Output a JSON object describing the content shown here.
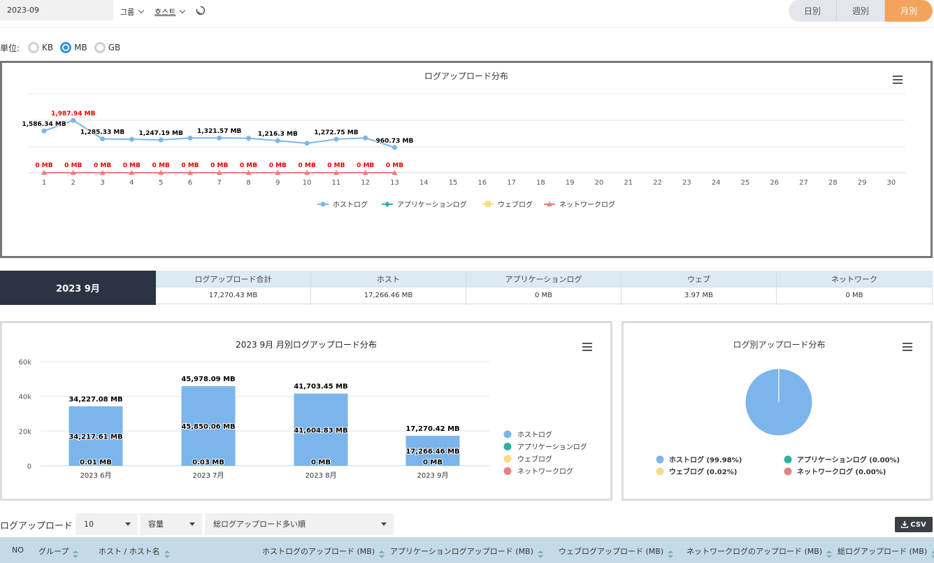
{
  "topbar": {
    "date": "2023-09",
    "group_label": "그룹",
    "host_label": "호스트",
    "period_buttons": [
      "日別",
      "週別",
      "月別"
    ],
    "active_period": "月別"
  },
  "units": {
    "label": "単位:",
    "options": [
      "KB",
      "MB",
      "GB"
    ],
    "selected": "MB"
  },
  "line_chart": {
    "title": "ログアップロード分布"
  },
  "summary": {
    "period": "2023 9月",
    "headers": [
      "ログアップロード合計",
      "ホスト",
      "アプリケーションログ",
      "ウェブ",
      "ネットワーク"
    ],
    "values": [
      "17,270.43 MB",
      "17,266.46 MB",
      "0 MB",
      "3.97 MB",
      "0 MB"
    ]
  },
  "bar_chart": {
    "title": "2023 9月 月別ログアップロード分布"
  },
  "pie_chart": {
    "title": "ログ別アップロード分布",
    "legend": [
      "ホストログ (99.98%)",
      "アプリケーションログ (0.00%)",
      "ウェブログ (0.02%)",
      "ネットワークログ (0.00%)"
    ]
  },
  "table_controls": {
    "title": "ログアップロード",
    "page_size": "10",
    "metric": "容量",
    "sort": "総ログアップロード多い順",
    "csv_label": "CSV"
  },
  "table_headers": [
    "NO",
    "グループ",
    "ホスト / ホスト名",
    "ホストログのアップロード (MB)",
    "アプリケーションログアップロード (MB)",
    "ウェブログアップロード (MB)",
    "ネットワークログのアップロード (MB)",
    "総ログアップロード (MB)"
  ],
  "colors": {
    "host": "#7cb5ec",
    "app": "#2bb3a0",
    "web": "#f7d98a",
    "network": "#e77f7f",
    "accent": "#f3a45c"
  },
  "chart_data": [
    {
      "type": "line",
      "title": "ログアップロード分布",
      "x": [
        1,
        2,
        3,
        4,
        5,
        6,
        7,
        8,
        9,
        10,
        11,
        12,
        13,
        14,
        15,
        16,
        17,
        18,
        19,
        20,
        21,
        22,
        23,
        24,
        25,
        26,
        27,
        28,
        29,
        30
      ],
      "series": [
        {
          "name": "ホストログ",
          "values": [
            1586.34,
            1987.94,
            1285.33,
            1270,
            1247.19,
            1318,
            1321.57,
            1310,
            1216.3,
            1120,
            1272.75,
            1320,
            960.73
          ]
        },
        {
          "name": "アプリケーションログ",
          "values": [
            0,
            0,
            0,
            0,
            0,
            0,
            0,
            0,
            0,
            0,
            0,
            0,
            0
          ]
        },
        {
          "name": "ウェブログ",
          "values": [
            0,
            0,
            0,
            0,
            0,
            0,
            0,
            0,
            0,
            0,
            0,
            0,
            0
          ]
        },
        {
          "name": "ネットワークログ",
          "values": [
            0,
            0,
            0,
            0,
            0,
            0,
            0,
            0,
            0,
            0,
            0,
            0,
            0
          ]
        }
      ],
      "labels": {
        "host": [
          {
            "day": 1,
            "text": "1,586.34 MB"
          },
          {
            "day": 2,
            "text": "1,987.94 MB"
          },
          {
            "day": 3,
            "text": "1,285.33 MB"
          },
          {
            "day": 5,
            "text": "1,247.19 MB"
          },
          {
            "day": 7,
            "text": "1,321.57 MB"
          },
          {
            "day": 9,
            "text": "1,216.3 MB"
          },
          {
            "day": 11,
            "text": "1,272.75 MB"
          },
          {
            "day": 13,
            "text": "960.73 MB"
          }
        ],
        "zero_label": "0 MB"
      },
      "ylim": [
        0,
        3000
      ],
      "legend": "bottom"
    },
    {
      "type": "bar",
      "title": "2023 9月 月別ログアップロード分布",
      "categories": [
        "2023 6月",
        "2023 7月",
        "2023 8月",
        "2023 9月"
      ],
      "series": [
        {
          "name": "ホストログ",
          "values": [
            34217.61,
            45850.06,
            41604.83,
            17266.46
          ]
        },
        {
          "name": "アプリケーションログ",
          "values": [
            0,
            0,
            0,
            0
          ]
        },
        {
          "name": "ウェブログ",
          "values": [
            0.01,
            0.03,
            0,
            0
          ]
        },
        {
          "name": "ネットワークログ",
          "values": [
            0,
            0,
            0,
            0
          ]
        }
      ],
      "totals": [
        "34,227.08 MB",
        "45,978.09 MB",
        "41,703.45 MB",
        "17,270.42 MB"
      ],
      "inner_labels": [
        "34,217.61 MB",
        "45,850.06 MB",
        "41,604.83 MB",
        "17,266.46 MB"
      ],
      "base_labels": [
        "0.01 MB",
        "0.03 MB",
        "0 MB",
        "0 MB"
      ],
      "yticks": [
        "0",
        "20k",
        "40k",
        "60k"
      ],
      "ylim": [
        0,
        60000
      ],
      "legend": "right"
    },
    {
      "type": "pie",
      "title": "ログ別アップロード分布",
      "categories": [
        "ホストログ",
        "アプリケーションログ",
        "ウェブログ",
        "ネットワークログ"
      ],
      "values": [
        99.98,
        0.0,
        0.02,
        0.0
      ],
      "legend": "bottom"
    }
  ]
}
